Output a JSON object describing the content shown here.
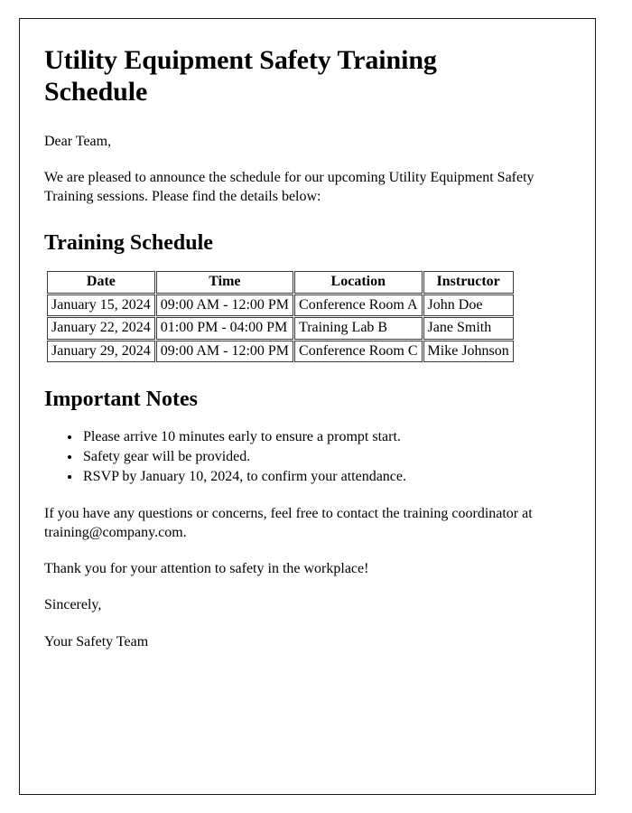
{
  "document": {
    "title": "Utility Equipment Safety Training Schedule",
    "salutation": "Dear Team,",
    "intro_paragraph": "We are pleased to announce the schedule for our upcoming Utility Equipment Safety Training sessions. Please find the details below:",
    "schedule_section": {
      "heading": "Training Schedule",
      "table": {
        "columns": [
          "Date",
          "Time",
          "Location",
          "Instructor"
        ],
        "rows": [
          {
            "date": "January 15, 2024",
            "time": "09:00 AM - 12:00 PM",
            "location": "Conference Room A",
            "instructor": "John Doe"
          },
          {
            "date": "January 22, 2024",
            "time": "01:00 PM - 04:00 PM",
            "location": "Training Lab B",
            "instructor": "Jane Smith"
          },
          {
            "date": "January 29, 2024",
            "time": "09:00 AM - 12:00 PM",
            "location": "Conference Room C",
            "instructor": "Mike Johnson"
          }
        ]
      }
    },
    "notes_section": {
      "heading": "Important Notes",
      "items": [
        "Please arrive 10 minutes early to ensure a prompt start.",
        "Safety gear will be provided.",
        "RSVP by January 10, 2024, to confirm your attendance."
      ]
    },
    "contact_paragraph": "If you have any questions or concerns, feel free to contact the training coordinator at training@company.com.",
    "thanks_paragraph": "Thank you for your attention to safety in the workplace!",
    "closing": "Sincerely,",
    "signature": "Your Safety Team"
  },
  "colors": {
    "page_border": "#1c1c1c",
    "text": "#000000",
    "table_border": "#3a3a3a",
    "background": "#ffffff"
  }
}
